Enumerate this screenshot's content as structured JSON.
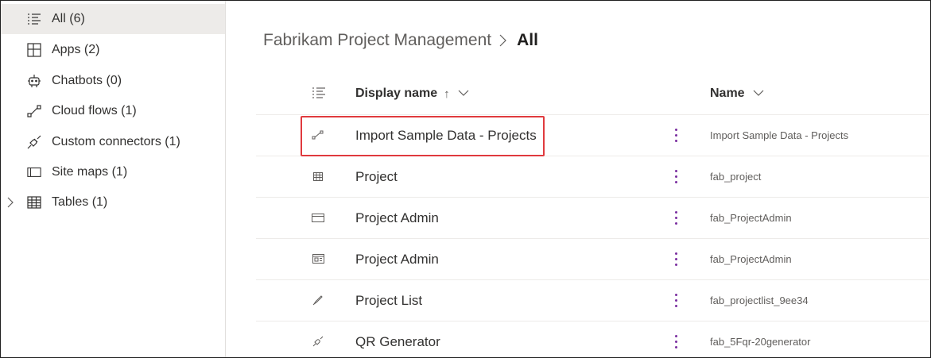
{
  "sidebar": {
    "items": [
      {
        "label": "All",
        "count": "(6)",
        "icon": "list-icon",
        "selected": true
      },
      {
        "label": "Apps",
        "count": "(2)",
        "icon": "apps-icon"
      },
      {
        "label": "Chatbots",
        "count": "(0)",
        "icon": "bot-icon"
      },
      {
        "label": "Cloud flows",
        "count": "(1)",
        "icon": "flow-icon"
      },
      {
        "label": "Custom connectors",
        "count": "(1)",
        "icon": "connector-icon"
      },
      {
        "label": "Site maps",
        "count": "(1)",
        "icon": "sitemap-icon"
      },
      {
        "label": "Tables",
        "count": "(1)",
        "icon": "table-icon",
        "expandable": true
      }
    ]
  },
  "breadcrumb": {
    "root": "Fabrikam Project Management",
    "current": "All"
  },
  "grid": {
    "columns": {
      "display_name": "Display name",
      "display_name_sort": "↑",
      "name": "Name"
    },
    "rows": [
      {
        "icon": "flow-icon",
        "display_name": "Import Sample Data - Projects",
        "name": "Import Sample Data - Projects"
      },
      {
        "icon": "table-icon",
        "display_name": "Project",
        "name": "fab_project"
      },
      {
        "icon": "sitemap-icon",
        "display_name": "Project Admin",
        "name": "fab_ProjectAdmin"
      },
      {
        "icon": "model-app-icon",
        "display_name": "Project Admin",
        "name": "fab_ProjectAdmin"
      },
      {
        "icon": "canvas-app-icon",
        "display_name": "Project List",
        "name": "fab_projectlist_9ee34"
      },
      {
        "icon": "connector-icon",
        "display_name": "QR Generator",
        "name": "fab_5Fqr-20generator"
      }
    ]
  },
  "colors": {
    "highlight": "#e03a3e",
    "selected_bg": "#edebe9",
    "more_dots": "#7b2fa0"
  }
}
